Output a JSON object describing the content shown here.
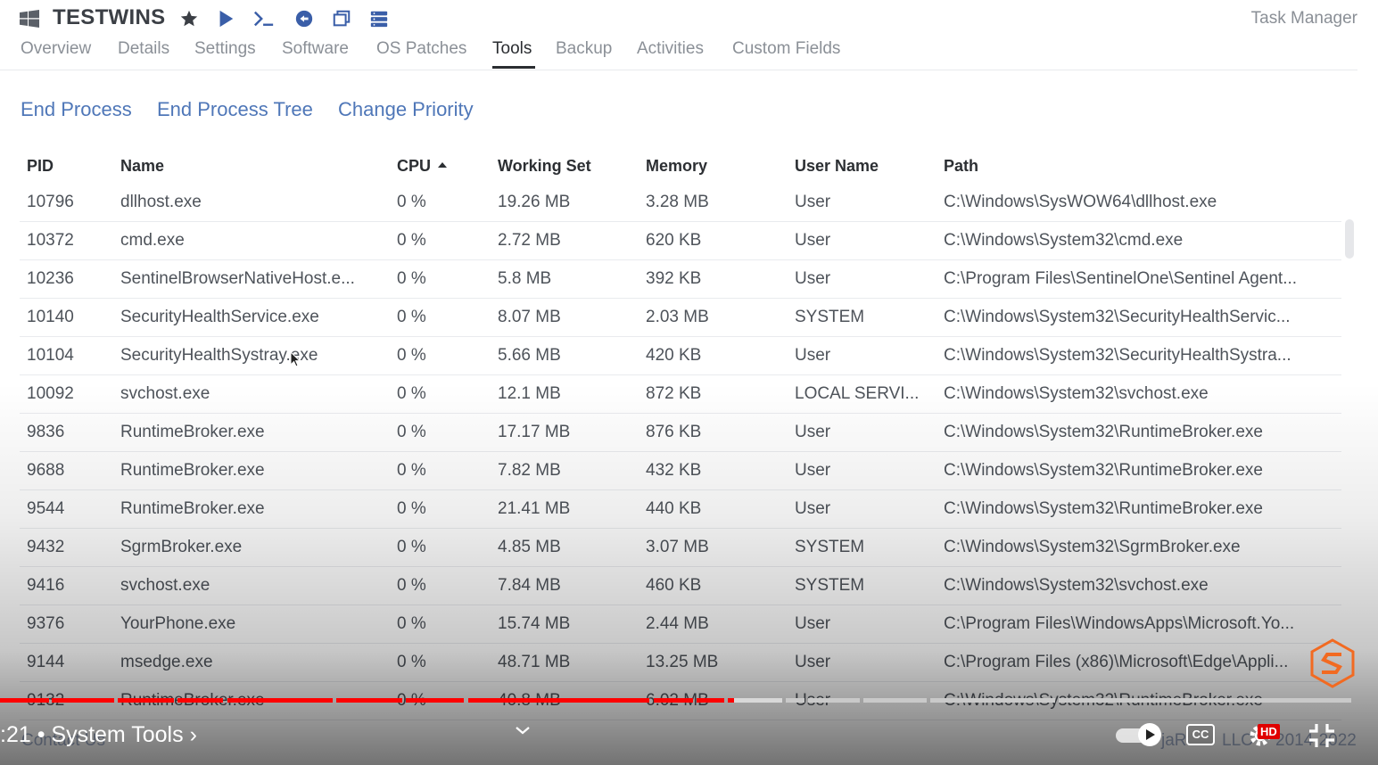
{
  "header": {
    "title": "TESTWINS",
    "right_label": "Task Manager",
    "icons": [
      "windows-logo-icon",
      "star-icon",
      "play-icon",
      "terminal-icon",
      "remote-icon",
      "window-icon",
      "server-icon"
    ]
  },
  "tabs": [
    {
      "label": "Overview",
      "active": false
    },
    {
      "label": "Details",
      "active": false
    },
    {
      "label": "Settings",
      "active": false
    },
    {
      "label": "Software",
      "active": false
    },
    {
      "label": "OS Patches",
      "active": false
    },
    {
      "label": "Tools",
      "active": true
    },
    {
      "label": "Backup",
      "active": false
    },
    {
      "label": "Activities",
      "active": false
    },
    {
      "label": "Custom Fields",
      "active": false
    }
  ],
  "actions": [
    "End Process",
    "End Process Tree",
    "Change Priority"
  ],
  "table": {
    "columns": [
      "PID",
      "Name",
      "CPU",
      "Working Set",
      "Memory",
      "User Name",
      "Path"
    ],
    "sorted_column": "CPU",
    "sort_direction": "ascending",
    "rows": [
      [
        "10796",
        "dllhost.exe",
        "0 %",
        "19.26 MB",
        "3.28 MB",
        "User",
        "C:\\Windows\\SysWOW64\\dllhost.exe"
      ],
      [
        "10372",
        "cmd.exe",
        "0 %",
        "2.72 MB",
        "620 KB",
        "User",
        "C:\\Windows\\System32\\cmd.exe"
      ],
      [
        "10236",
        "SentinelBrowserNativeHost.e...",
        "0 %",
        "5.8 MB",
        "392 KB",
        "User",
        "C:\\Program Files\\SentinelOne\\Sentinel Agent..."
      ],
      [
        "10140",
        "SecurityHealthService.exe",
        "0 %",
        "8.07 MB",
        "2.03 MB",
        "SYSTEM",
        "C:\\Windows\\System32\\SecurityHealthServic..."
      ],
      [
        "10104",
        "SecurityHealthSystray.exe",
        "0 %",
        "5.66 MB",
        "420 KB",
        "User",
        "C:\\Windows\\System32\\SecurityHealthSystra..."
      ],
      [
        "10092",
        "svchost.exe",
        "0 %",
        "12.1 MB",
        "872 KB",
        "LOCAL SERVI...",
        "C:\\Windows\\System32\\svchost.exe"
      ],
      [
        "9836",
        "RuntimeBroker.exe",
        "0 %",
        "17.17 MB",
        "876 KB",
        "User",
        "C:\\Windows\\System32\\RuntimeBroker.exe"
      ],
      [
        "9688",
        "RuntimeBroker.exe",
        "0 %",
        "7.82 MB",
        "432 KB",
        "User",
        "C:\\Windows\\System32\\RuntimeBroker.exe"
      ],
      [
        "9544",
        "RuntimeBroker.exe",
        "0 %",
        "21.41 MB",
        "440 KB",
        "User",
        "C:\\Windows\\System32\\RuntimeBroker.exe"
      ],
      [
        "9432",
        "SgrmBroker.exe",
        "0 %",
        "4.85 MB",
        "3.07 MB",
        "SYSTEM",
        "C:\\Windows\\System32\\SgrmBroker.exe"
      ],
      [
        "9416",
        "svchost.exe",
        "0 %",
        "7.84 MB",
        "460 KB",
        "SYSTEM",
        "C:\\Windows\\System32\\svchost.exe"
      ],
      [
        "9376",
        "YourPhone.exe",
        "0 %",
        "15.74 MB",
        "2.44 MB",
        "User",
        "C:\\Program Files\\WindowsApps\\Microsoft.Yo..."
      ],
      [
        "9144",
        "msedge.exe",
        "0 %",
        "48.71 MB",
        "13.25 MB",
        "User",
        "C:\\Program Files (x86)\\Microsoft\\Edge\\Appli..."
      ],
      [
        "9132",
        "RuntimeBroker.exe",
        "0 %",
        "40.8 MB",
        "6.02 MB",
        "User",
        "C:\\Windows\\System32\\RuntimeBroker.exe"
      ]
    ]
  },
  "video_player": {
    "chapter_label": ":21 • System Tools",
    "progress_played_fraction": 0.543,
    "colors": {
      "played": "#ff0000",
      "buffered": "#d8d8d8",
      "unplayed": "#c9c9c9"
    },
    "overlay_text_left": "Contact Us",
    "overlay_text_right_1": "jaR",
    "overlay_text_right_2": "LLC",
    "overlay_text_right_3": "2014-2022",
    "controls": [
      "autoplay-toggle-icon",
      "closed-captions-icon",
      "settings-gear-icon",
      "exit-fullscreen-icon"
    ],
    "hd_badge": "HD",
    "cc_label": "CC"
  },
  "colors": {
    "link": "#4f77b8",
    "accent_icon": "#3a5ea8",
    "logo": "#f26a21"
  }
}
